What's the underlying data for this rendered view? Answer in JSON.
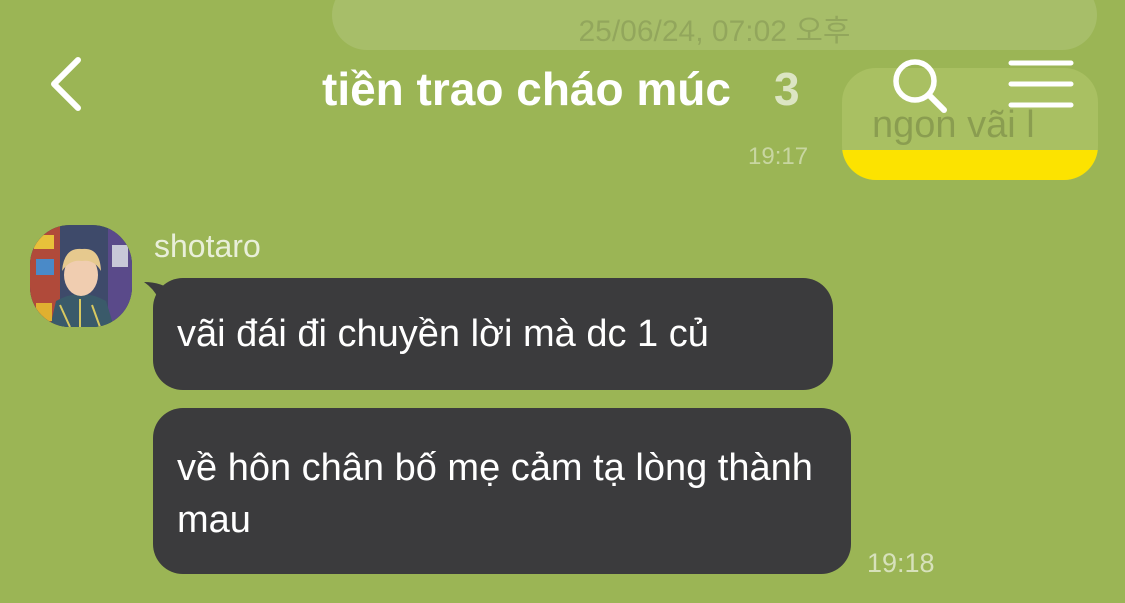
{
  "date_separator": "25/06/24, 07:02 오후",
  "header": {
    "back_icon": "chevron-left-icon",
    "title": "tiền trao cháo múc",
    "member_count": "3",
    "search_icon": "search-icon",
    "menu_icon": "hamburger-menu-icon"
  },
  "outgoing": {
    "text": "ngon vãi l",
    "time": "19:17"
  },
  "incoming": {
    "sender": "shotaro",
    "messages": [
      {
        "text": "vãi đái đi chuyền lời mà dc 1 củ"
      },
      {
        "text": "về hôn chân bố mẹ cảm tạ lòng thành mau"
      }
    ],
    "time": "19:18"
  },
  "colors": {
    "background": "#9bb555",
    "incoming_bubble": "#3b3b3d",
    "outgoing_bubble": "#fce300",
    "text_light": "#ffffff"
  }
}
